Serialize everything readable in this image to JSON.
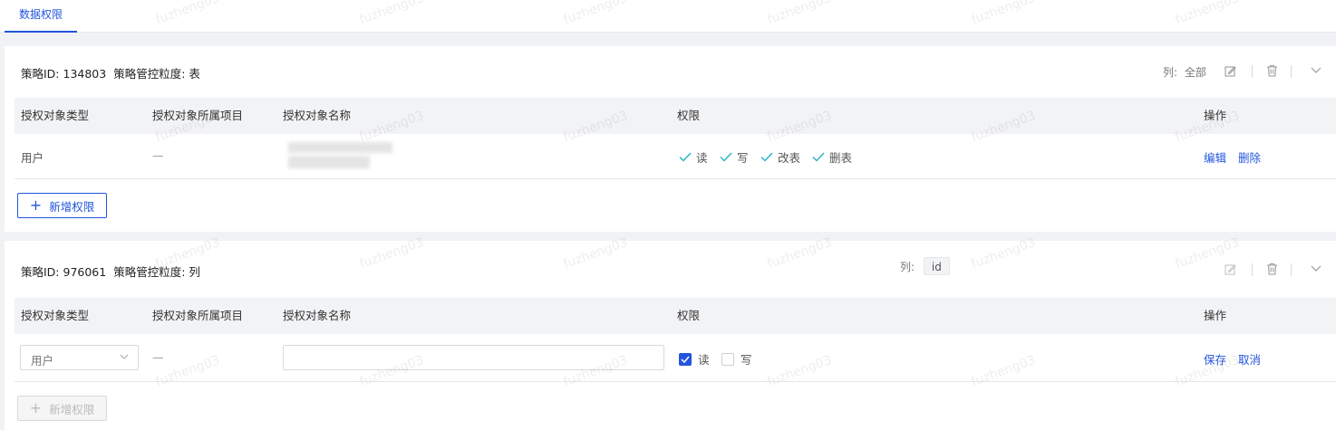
{
  "tabs": [
    {
      "label": "数据权限",
      "active": true
    }
  ],
  "table_headers": [
    "授权对象类型",
    "授权对象所属项目",
    "授权对象名称",
    "权限",
    "操作"
  ],
  "policies": [
    {
      "id_text": "策略ID: 134803",
      "granularity_text": "策略管控粒度: 表",
      "columns_label": "列:",
      "columns_value": "全部",
      "row": {
        "type": "用户",
        "project": "—",
        "name": "",
        "permissions": [
          "读",
          "写",
          "改表",
          "删表"
        ],
        "actions": [
          "编辑",
          "删除"
        ]
      },
      "add_label": "新增权限"
    },
    {
      "id_text": "策略ID: 976061",
      "granularity_text": "策略管控粒度: 列",
      "columns_label": "列:",
      "columns_value": "id",
      "row": {
        "type_select": "用户",
        "project": "—",
        "name_input": "",
        "checkboxes": [
          {
            "label": "读",
            "checked": true
          },
          {
            "label": "写",
            "checked": false
          }
        ],
        "actions": [
          "保存",
          "取消"
        ]
      },
      "add_label": "新增权限",
      "add_disabled": true
    }
  ],
  "watermark_text": "fuzheng03",
  "colors": {
    "accent": "#2255dd",
    "check": "#26b3c6",
    "header_bg": "#f2f3f5"
  }
}
